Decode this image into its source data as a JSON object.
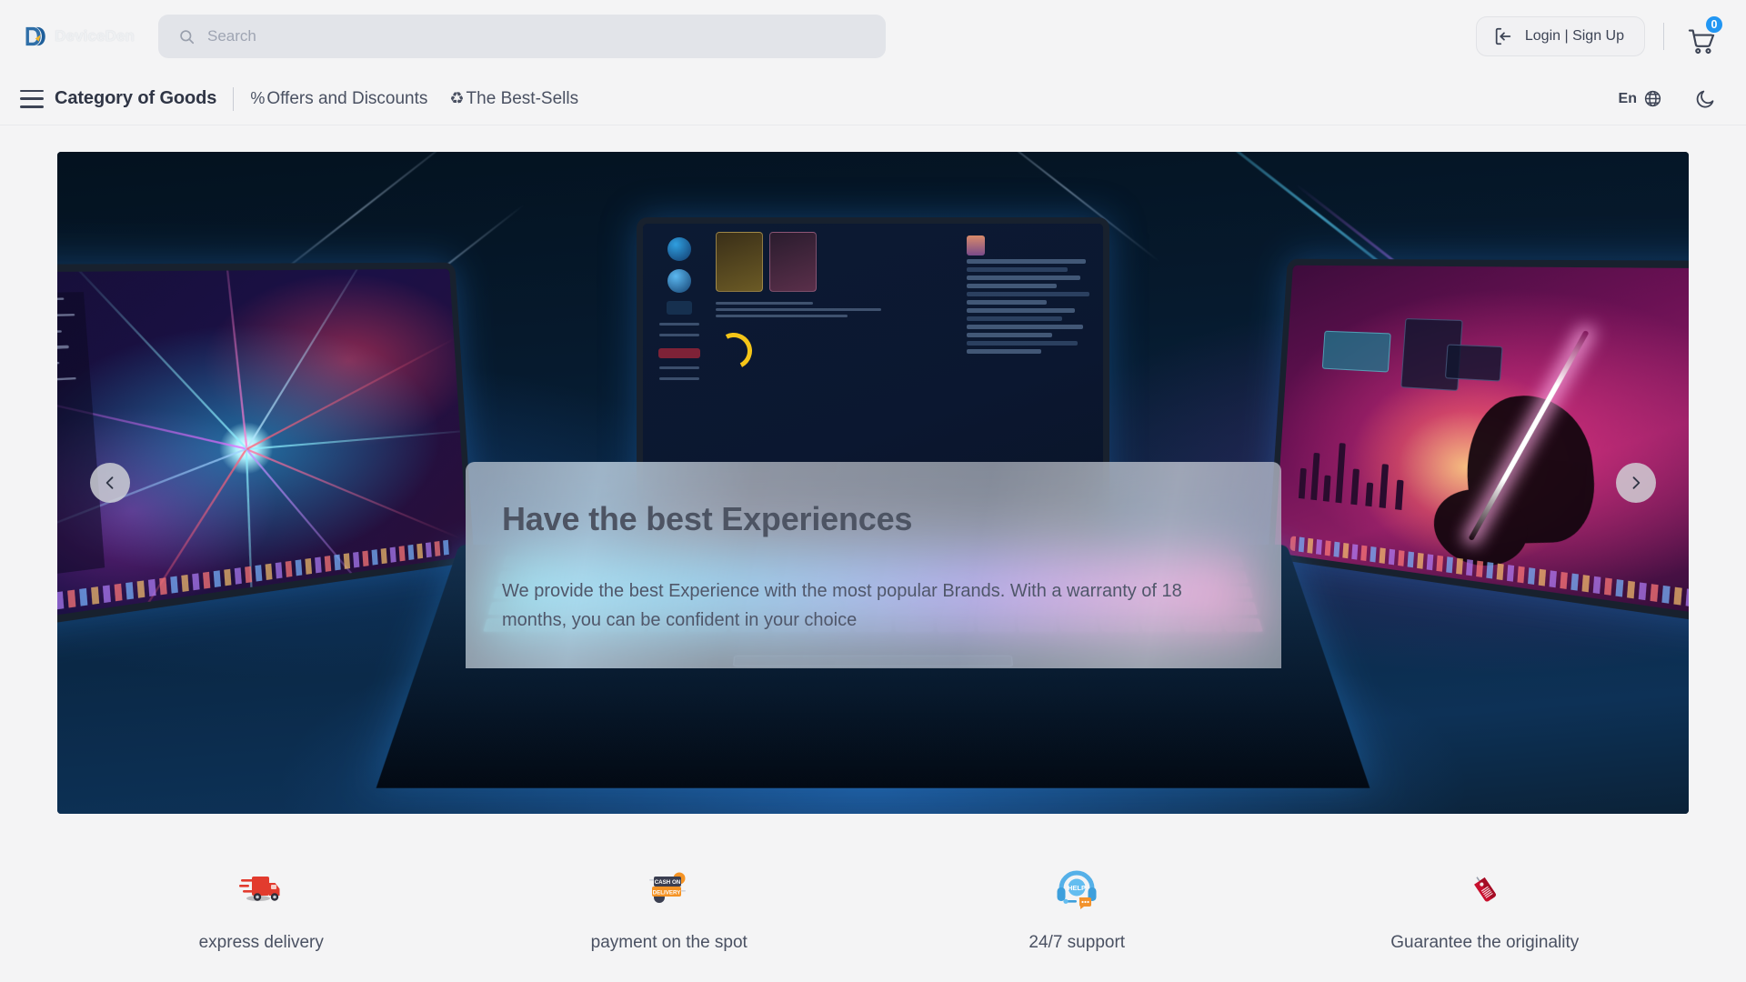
{
  "header": {
    "brand_name": "DeviceDen",
    "brand_mark_icon": "dd-monogram-logo",
    "search": {
      "icon": "search-icon",
      "placeholder": "Search",
      "value": ""
    },
    "login_button": {
      "label": "Login | Sign Up",
      "icon": "login-arrow-icon"
    },
    "cart": {
      "icon": "shopping-cart-icon",
      "badge_count": "0",
      "badge_color": "#2196f3"
    }
  },
  "nav": {
    "menu_icon": "hamburger-menu-icon",
    "primary": "Category of Goods",
    "links": [
      {
        "icon_char": "%",
        "icon_name": "percent-icon",
        "label": "Offers and Discounts"
      },
      {
        "icon_char": "♻",
        "icon_name": "flame-icon",
        "label": "The Best-Sells"
      }
    ],
    "language": {
      "label": "En",
      "icon": "globe-icon"
    },
    "theme_toggle": {
      "icon": "moon-icon"
    }
  },
  "hero": {
    "title": "Have the best Experiences",
    "description": "We provide the best Experience with the most popular Brands. With a warranty of 18 months, you can be confident in your choice",
    "prev_icon": "chevron-left-icon",
    "next_icon": "chevron-right-icon",
    "background_color": "#051424"
  },
  "features": [
    {
      "icon": "delivery-truck-icon",
      "label": "express delivery"
    },
    {
      "icon": "cash-on-delivery-icon",
      "label": "payment on the spot"
    },
    {
      "icon": "headset-support-icon",
      "label": "24/7 support"
    },
    {
      "icon": "price-tag-icon",
      "label": "Guarantee the originality"
    }
  ]
}
